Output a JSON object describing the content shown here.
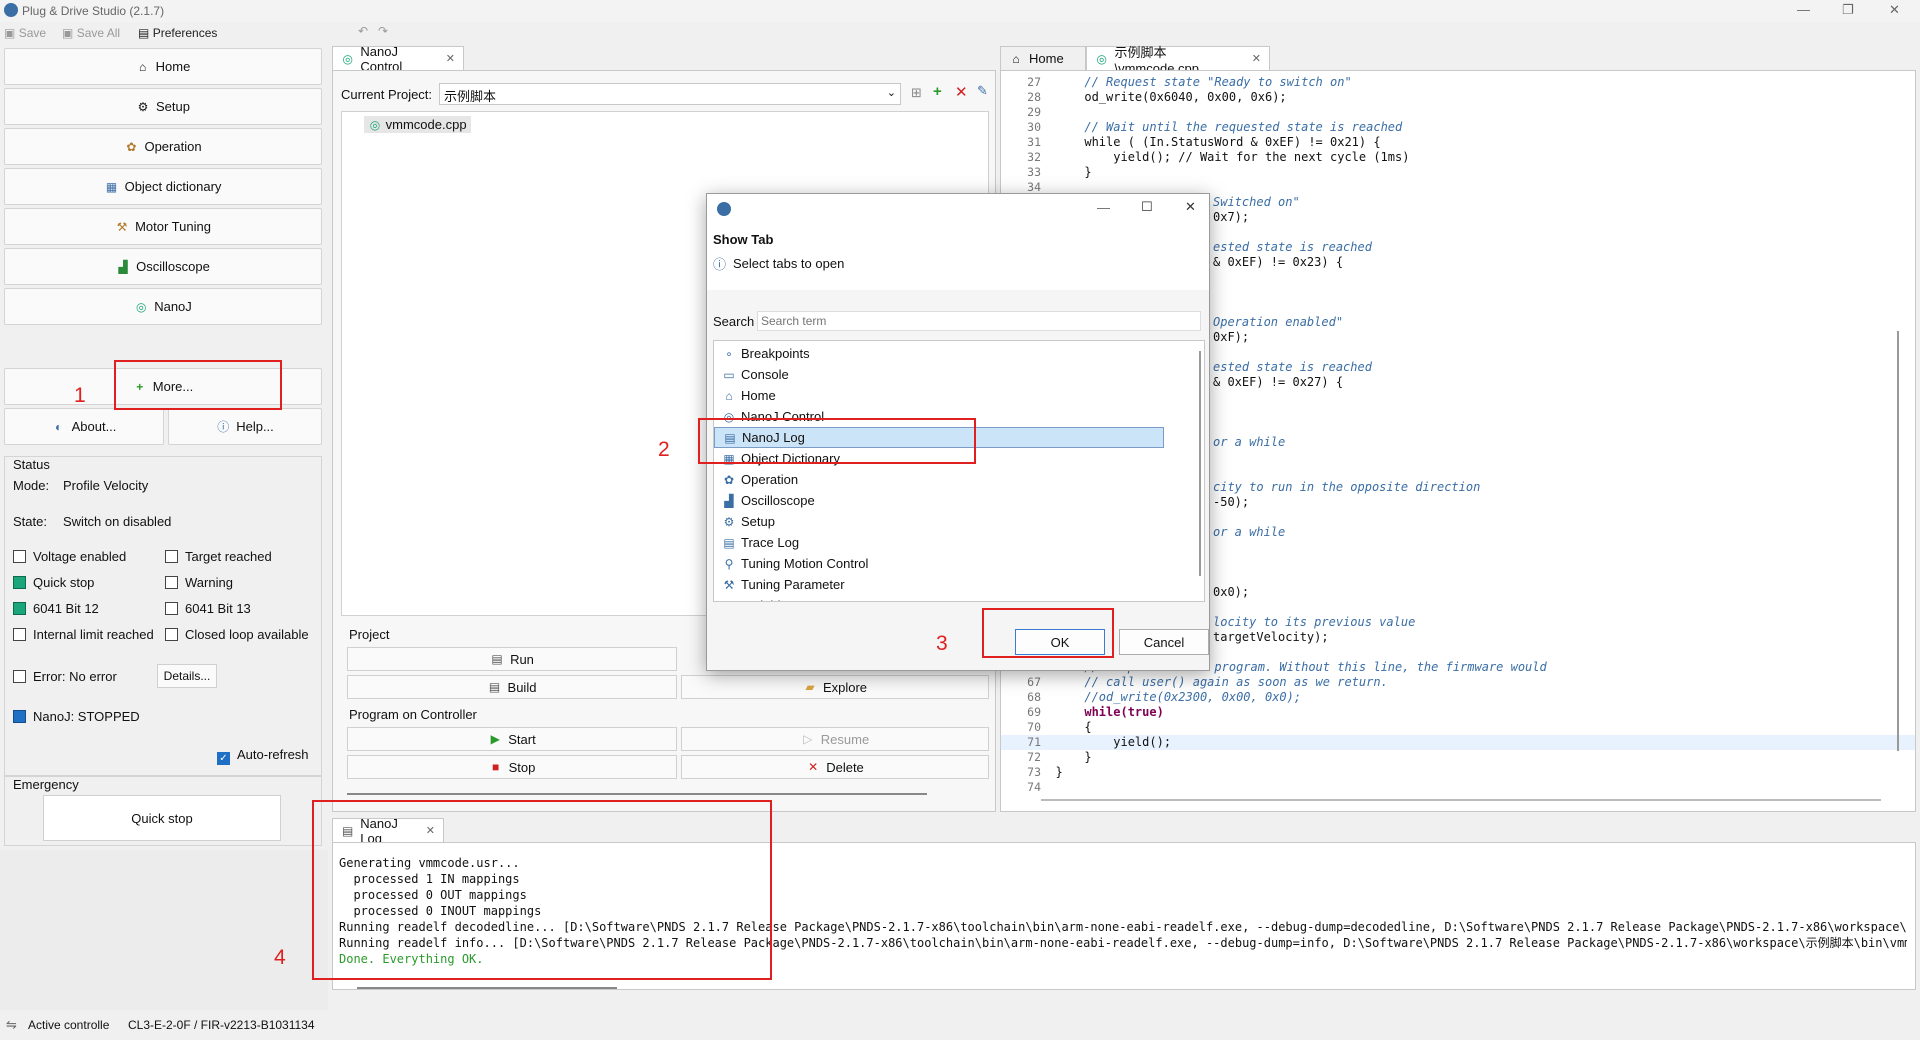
{
  "app": {
    "title": "Plug & Drive Studio (2.1.7)"
  },
  "toolbar": {
    "save": "Save",
    "save_all": "Save All",
    "preferences": "Preferences"
  },
  "left_nav": {
    "items": [
      {
        "label": "Home",
        "icon": "home-icon"
      },
      {
        "label": "Setup",
        "icon": "setup-icon"
      },
      {
        "label": "Operation",
        "icon": "operation-icon"
      },
      {
        "label": "Object dictionary",
        "icon": "object-dictionary-icon"
      },
      {
        "label": "Motor Tuning",
        "icon": "motor-tuning-icon"
      },
      {
        "label": "Oscilloscope",
        "icon": "oscilloscope-icon"
      },
      {
        "label": "NanoJ",
        "icon": "nanoj-icon"
      }
    ],
    "more": "More...",
    "about": "About...",
    "help": "Help..."
  },
  "status": {
    "group_title": "Status",
    "mode_label": "Mode:",
    "mode_value": "Profile Velocity",
    "state_label": "State:",
    "state_value": "Switch on disabled",
    "flags": {
      "voltage_enabled": "Voltage enabled",
      "target_reached": "Target reached",
      "quick_stop": "Quick stop",
      "warning": "Warning",
      "bit12": "6041 Bit 12",
      "bit13": "6041 Bit 13",
      "internal_limit": "Internal limit reached",
      "closed_loop": "Closed loop available"
    },
    "error": "Error:  No error",
    "details": "Details...",
    "nanoj": "NanoJ:  STOPPED",
    "auto_refresh": "Auto-refresh"
  },
  "emergency": {
    "group_title": "Emergency",
    "quick_stop": "Quick stop"
  },
  "nanoj_control": {
    "tab": "NanoJ Control",
    "current_project_label": "Current Project:",
    "current_project_value": "示例脚本",
    "file": "vmmcode.cpp",
    "project_group": "Project",
    "run": "Run",
    "build": "Build",
    "explore": "Explore",
    "program_group": "Program on Controller",
    "start": "Start",
    "resume": "Resume",
    "stop": "Stop",
    "delete": "Delete"
  },
  "editor": {
    "tabs": [
      {
        "label": "Home"
      },
      {
        "label": "示例脚本\\vmmcode.cpp"
      }
    ],
    "lines": [
      {
        "n": "27",
        "left": "    ",
        "right": "// Request state \"Ready to switch on\"",
        "cls": "cm"
      },
      {
        "n": "28",
        "left": "    ",
        "right": "od_write(0x6040, 0x00, 0x6);",
        "cls": ""
      },
      {
        "n": "29",
        "left": "",
        "right": "",
        "cls": ""
      },
      {
        "n": "30",
        "left": "    ",
        "right": "// Wait until the requested state is reached",
        "cls": "cm"
      },
      {
        "n": "31",
        "left": "    ",
        "right": "while ( (In.StatusWord & 0xEF) != 0x21) {",
        "cls": "kwline"
      },
      {
        "n": "32",
        "left": "        ",
        "right": "yield(); // Wait for the next cycle (1ms)",
        "cls": "yield"
      },
      {
        "n": "33",
        "left": "    ",
        "right": "}",
        "cls": ""
      },
      {
        "n": "34",
        "left": "",
        "right": "",
        "cls": ""
      }
    ],
    "partial_lines": [
      {
        "text": "Switched on\"",
        "cls": "cm"
      },
      {
        "text": "0x7);",
        "cls": ""
      },
      {
        "text": "",
        "cls": ""
      },
      {
        "text": "ested state is reached",
        "cls": "cm"
      },
      {
        "text": "& 0xEF) != 0x23) {",
        "cls": ""
      },
      {
        "text": "",
        "cls": ""
      },
      {
        "text": "",
        "cls": ""
      },
      {
        "text": "",
        "cls": ""
      },
      {
        "text": "Operation enabled\"",
        "cls": "cm"
      },
      {
        "text": "0xF);",
        "cls": ""
      },
      {
        "text": "",
        "cls": ""
      },
      {
        "text": "ested state is reached",
        "cls": "cm"
      },
      {
        "text": "& 0xEF) != 0x27) {",
        "cls": ""
      },
      {
        "text": "",
        "cls": ""
      },
      {
        "text": "",
        "cls": ""
      },
      {
        "text": "",
        "cls": ""
      },
      {
        "text": "or a while",
        "cls": "cm"
      },
      {
        "text": "",
        "cls": ""
      },
      {
        "text": "",
        "cls": ""
      },
      {
        "text": "city to run in the opposite direction",
        "cls": "cm"
      },
      {
        "text": "-50);",
        "cls": ""
      },
      {
        "text": "",
        "cls": ""
      },
      {
        "text": "or a while",
        "cls": "cm"
      },
      {
        "text": "",
        "cls": ""
      },
      {
        "text": "",
        "cls": ""
      },
      {
        "text": "",
        "cls": ""
      },
      {
        "text": "0x0);",
        "cls": ""
      },
      {
        "text": "",
        "cls": ""
      },
      {
        "text": "locity to its previous value",
        "cls": "cm"
      },
      {
        "text": "targetVelocity);",
        "cls": ""
      }
    ],
    "tail_lines": [
      {
        "n": "",
        "left": "    ",
        "right": "// Stop the NanoJ program. Without this line, the firmware would",
        "cls": "cm"
      },
      {
        "n": "67",
        "left": "    ",
        "right": "// call user() again as soon as we return.",
        "cls": "cm"
      },
      {
        "n": "68",
        "left": "    ",
        "right": "//od_write(0x2300, 0x00, 0x0);",
        "cls": "cm"
      },
      {
        "n": "69",
        "left": "    ",
        "right": "while(true)",
        "cls": "kw"
      },
      {
        "n": "70",
        "left": "    ",
        "right": "{",
        "cls": ""
      },
      {
        "n": "71",
        "left": "        ",
        "right": "yield();",
        "cls": ""
      },
      {
        "n": "72",
        "left": "    ",
        "right": "}",
        "cls": ""
      },
      {
        "n": "73",
        "left": "",
        "right": "}",
        "cls": ""
      },
      {
        "n": "74",
        "left": "",
        "right": "",
        "cls": ""
      }
    ]
  },
  "dialog": {
    "title": "Show Tab",
    "subtitle": "Select tabs to open",
    "search_label": "Search",
    "search_placeholder": "Search term",
    "items": [
      {
        "label": "Breakpoints",
        "icon": "breakpoints-icon",
        "glyph": "∘"
      },
      {
        "label": "Console",
        "icon": "console-icon",
        "glyph": "▭"
      },
      {
        "label": "Home",
        "icon": "home-icon",
        "glyph": "⌂"
      },
      {
        "label": "NanoJ Control",
        "icon": "nanoj-control-icon",
        "glyph": "◎"
      },
      {
        "label": "NanoJ Log",
        "icon": "nanoj-log-icon",
        "glyph": "▤"
      },
      {
        "label": "Object Dictionary",
        "icon": "object-dictionary-icon",
        "glyph": "▦"
      },
      {
        "label": "Operation",
        "icon": "operation-icon",
        "glyph": "✿"
      },
      {
        "label": "Oscilloscope",
        "icon": "oscilloscope-icon",
        "glyph": "▟"
      },
      {
        "label": "Setup",
        "icon": "setup-icon",
        "glyph": "⚙"
      },
      {
        "label": "Trace Log",
        "icon": "trace-log-icon",
        "glyph": "▤"
      },
      {
        "label": "Tuning Motion Control",
        "icon": "tuning-motion-icon",
        "glyph": "⚲"
      },
      {
        "label": "Tuning Parameter",
        "icon": "tuning-parameter-icon",
        "glyph": "⚒"
      },
      {
        "label": "Variables",
        "icon": "variables-icon",
        "glyph": "▣"
      }
    ],
    "ok": "OK",
    "cancel": "Cancel"
  },
  "nanoj_log": {
    "tab": "NanoJ Log",
    "lines": [
      "Generating vmmcode.usr...",
      "  processed 1 IN mappings",
      "  processed 0 OUT mappings",
      "  processed 0 INOUT mappings",
      "Running readelf decodedline... [D:\\Software\\PNDS 2.1.7 Release Package\\PNDS-2.1.7-x86\\toolchain\\bin\\arm-none-eabi-readelf.exe, --debug-dump=decodedline, D:\\Software\\PNDS 2.1.7 Release Package\\PNDS-2.1.7-x86\\workspace\\示例脚",
      "Running readelf info... [D:\\Software\\PNDS 2.1.7 Release Package\\PNDS-2.1.7-x86\\toolchain\\bin\\arm-none-eabi-readelf.exe, --debug-dump=info, D:\\Software\\PNDS 2.1.7 Release Package\\PNDS-2.1.7-x86\\workspace\\示例脚本\\bin\\vmmcode"
    ],
    "done": "Done. Everything OK."
  },
  "statusbar": {
    "active": "Active controlle",
    "firmware": "CL3-E-2-0F / FIR-v2213-B1031134"
  },
  "annotations": [
    "1",
    "2",
    "3",
    "4"
  ],
  "colors": {
    "accent_green": "#1aa57a",
    "annotation_red": "#e02020",
    "selection_blue": "#cce4f7",
    "comment_blue": "#3a6ea5"
  }
}
